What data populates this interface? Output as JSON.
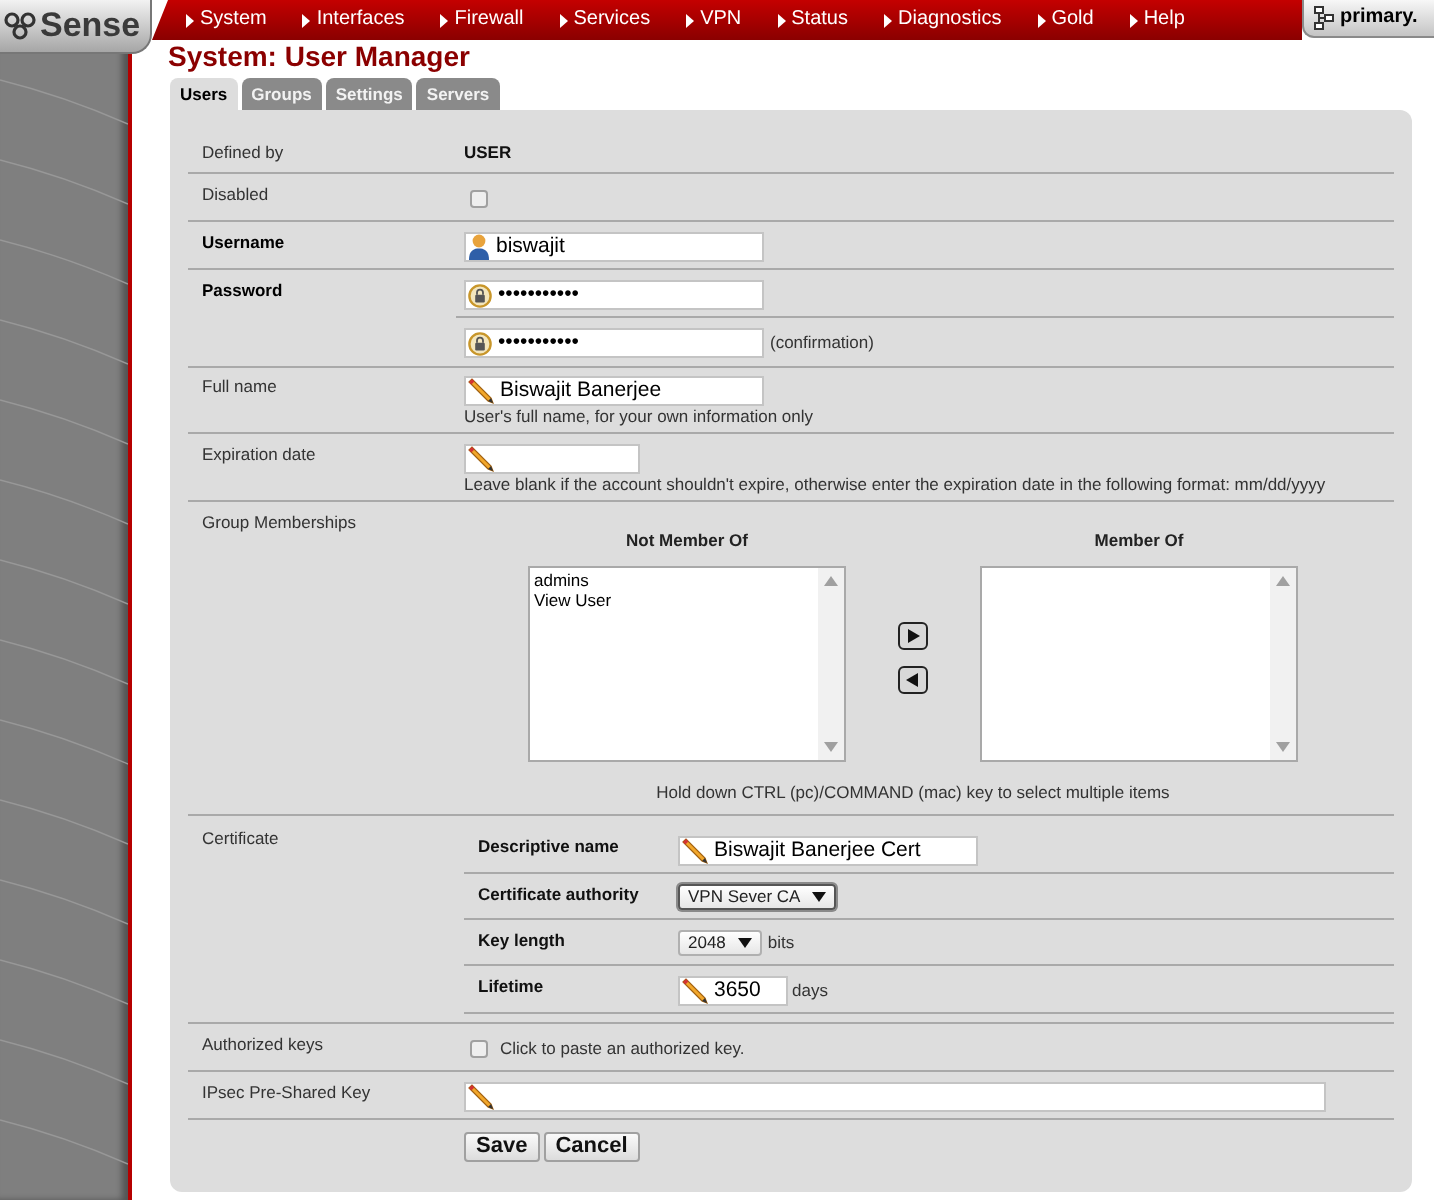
{
  "header": {
    "logo": "Sense",
    "nav": [
      {
        "label": "System"
      },
      {
        "label": "Interfaces"
      },
      {
        "label": "Firewall"
      },
      {
        "label": "Services"
      },
      {
        "label": "VPN"
      },
      {
        "label": "Status"
      },
      {
        "label": "Diagnostics"
      },
      {
        "label": "Gold"
      },
      {
        "label": "Help"
      }
    ],
    "host": "primary."
  },
  "page_title": "System: User Manager",
  "tabs": [
    {
      "label": "Users",
      "selected": true
    },
    {
      "label": "Groups",
      "selected": false
    },
    {
      "label": "Settings",
      "selected": false
    },
    {
      "label": "Servers",
      "selected": false
    }
  ],
  "rows": [
    {
      "kind": "static",
      "label": "Defined by",
      "required": false,
      "value": "USER"
    },
    {
      "kind": "checkbox",
      "label": "Disabled",
      "required": false,
      "checked": false
    },
    {
      "kind": "username",
      "label": "Username",
      "required": true,
      "value": "biswajit"
    },
    {
      "kind": "password",
      "label": "Password",
      "required": true,
      "value": "•••••••••••",
      "confirmation": {
        "value": "•••••••••••",
        "note": "(confirmation)"
      }
    },
    {
      "kind": "text",
      "label": "Full name",
      "required": false,
      "value": "Biswajit Banerjee",
      "hint": "User's full name, for your own information only"
    },
    {
      "kind": "date",
      "label": "Expiration date",
      "required": false,
      "hint": "Leave blank if the account shouldn't expire, otherwise enter the expiration date in the following format: mm/dd/yyyy"
    },
    {
      "kind": "groups",
      "label": "Group Memberships",
      "required": false,
      "lists": [
        {
          "title": "Not Member Of",
          "items": [
            "admins",
            "View User"
          ]
        },
        {
          "title": "Member Of"
        }
      ],
      "hint": "Hold down CTRL (pc)/COMMAND (mac) key to select multiple items"
    },
    {
      "kind": "certificate",
      "label": "Certificate",
      "required": false,
      "fields": [
        {
          "kind": "text",
          "label": "Descriptive name",
          "value": "Biswajit Banerjee Cert"
        },
        {
          "kind": "select",
          "label": "Certificate authority",
          "value": "VPN Sever CA",
          "focused": true
        },
        {
          "kind": "select",
          "label": "Key length",
          "value": "2048",
          "unit": "bits",
          "focused": false
        },
        {
          "kind": "number",
          "label": "Lifetime",
          "value": "3650",
          "unit": "days"
        }
      ]
    },
    {
      "kind": "checkbox",
      "label": "Authorized keys",
      "required": false,
      "checked": false,
      "note": "Click to paste an authorized key."
    },
    {
      "kind": "key",
      "label": "IPsec Pre-Shared Key",
      "required": false
    }
  ],
  "buttons": [
    "Save",
    "Cancel"
  ]
}
